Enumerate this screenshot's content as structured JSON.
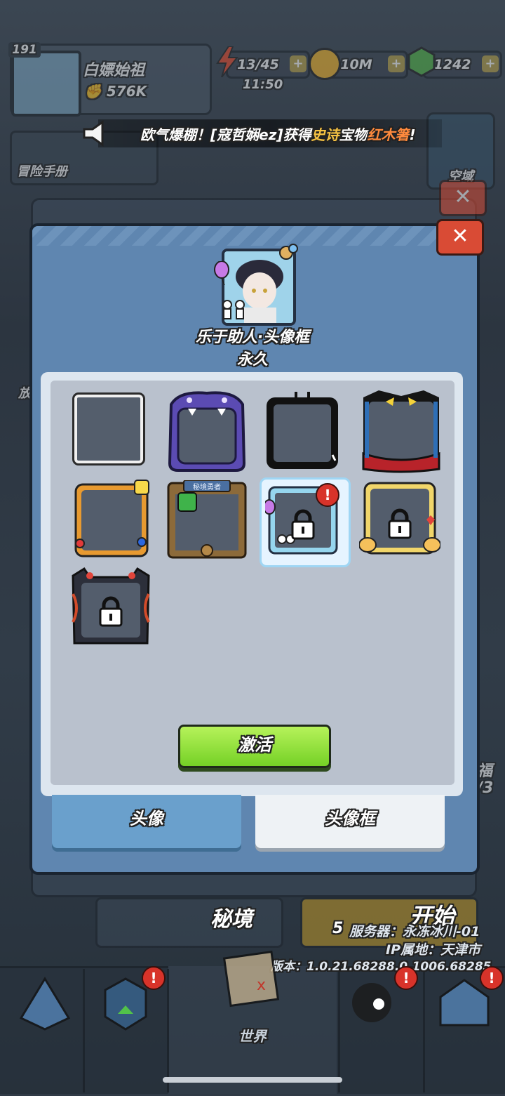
{
  "hud": {
    "level": "191",
    "player_name": "白嫖始祖",
    "power": "576K",
    "energy": "13/45",
    "gold": "10M",
    "gems": "1242",
    "timer": "11:50",
    "plus": "+"
  },
  "ticker": {
    "prefix": "欧气爆棚！[寇哲娴ez]获得",
    "rarity": "史诗",
    "mid": "宝物",
    "item": "红木箸",
    "suffix": "!"
  },
  "side": {
    "adventure_book": "冒险手册",
    "arena": "空域"
  },
  "modal": {
    "close": "✕",
    "frame_name": "乐于助人·头像框",
    "duration": "永久",
    "frames": [
      {
        "name": "default",
        "locked": false
      },
      {
        "name": "purple-monster",
        "locked": false
      },
      {
        "name": "black-antenna",
        "locked": false
      },
      {
        "name": "yellow-eyes-scarf",
        "locked": false
      },
      {
        "name": "game-controller",
        "locked": false
      },
      {
        "name": "secret-realm-hero",
        "locked": false,
        "plaque": "秘境勇者"
      },
      {
        "name": "helpful",
        "locked": true,
        "selected": true
      },
      {
        "name": "thumbs-up",
        "locked": true
      },
      {
        "name": "demon-horns",
        "locked": true
      }
    ],
    "activate_label": "激活",
    "tabs": {
      "avatar": "头像",
      "frame": "头像框"
    }
  },
  "bottom": {
    "secret_realm": "秘境",
    "start": "开始",
    "stamina_cost": "5",
    "server": "服务器：永冻冰川-01",
    "ip": "IP属地：天津市",
    "version": "版本：1.0.21.68288.0.1006.68285",
    "world": "世界",
    "left_edge": "放",
    "right_edge_1": "福",
    "right_edge_2": "/3",
    "alert": "!"
  },
  "colors": {
    "accent_green": "#75d126",
    "close_red": "#d94b35",
    "modal_blue": "#5f86b0",
    "rarity_gold": "#f6c343",
    "item_orange": "#ff8a3d"
  }
}
